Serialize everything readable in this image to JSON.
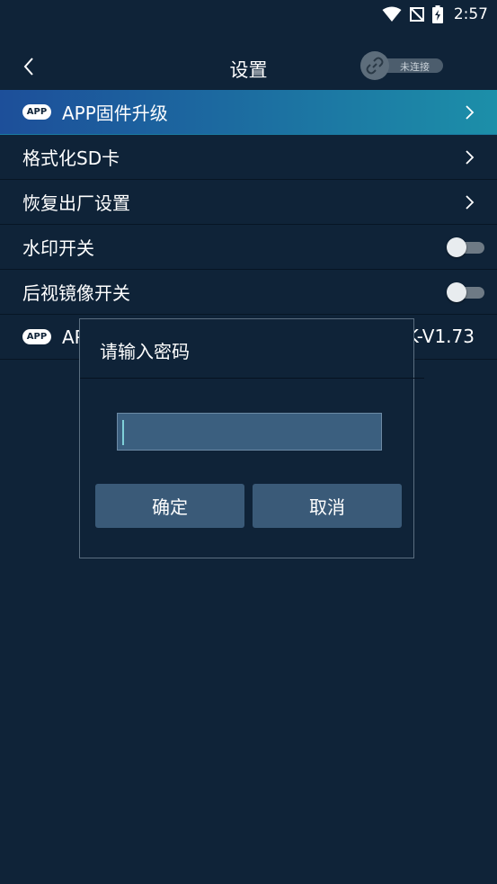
{
  "status_bar": {
    "time": "2:57",
    "icons": [
      "wifi-icon",
      "no-signal-icon",
      "battery-charging-icon"
    ]
  },
  "header": {
    "title": "设置",
    "back_icon": "chevron-left-icon",
    "connection": {
      "label": "未连接",
      "icon": "link-icon"
    }
  },
  "settings": {
    "items": [
      {
        "label": "APP固件升级",
        "badge": "APP",
        "control": "chevron",
        "highlighted": true
      },
      {
        "label": "格式化SD卡",
        "control": "chevron"
      },
      {
        "label": "恢复出厂设置",
        "control": "chevron"
      },
      {
        "label": "水印开关",
        "control": "toggle",
        "on": false
      },
      {
        "label": "后视镜像开关",
        "control": "toggle",
        "on": false
      },
      {
        "label": "AP",
        "badge": "APP",
        "value": "K-V1.73"
      }
    ]
  },
  "dialog": {
    "title": "请输入密码",
    "input_value": "",
    "confirm_label": "确定",
    "cancel_label": "取消"
  },
  "colors": {
    "background": "#0f2338",
    "highlight_start": "#1d4f9a",
    "highlight_end": "#1c8fa9",
    "button": "#3a5a78",
    "input": "#3b5f7f"
  }
}
